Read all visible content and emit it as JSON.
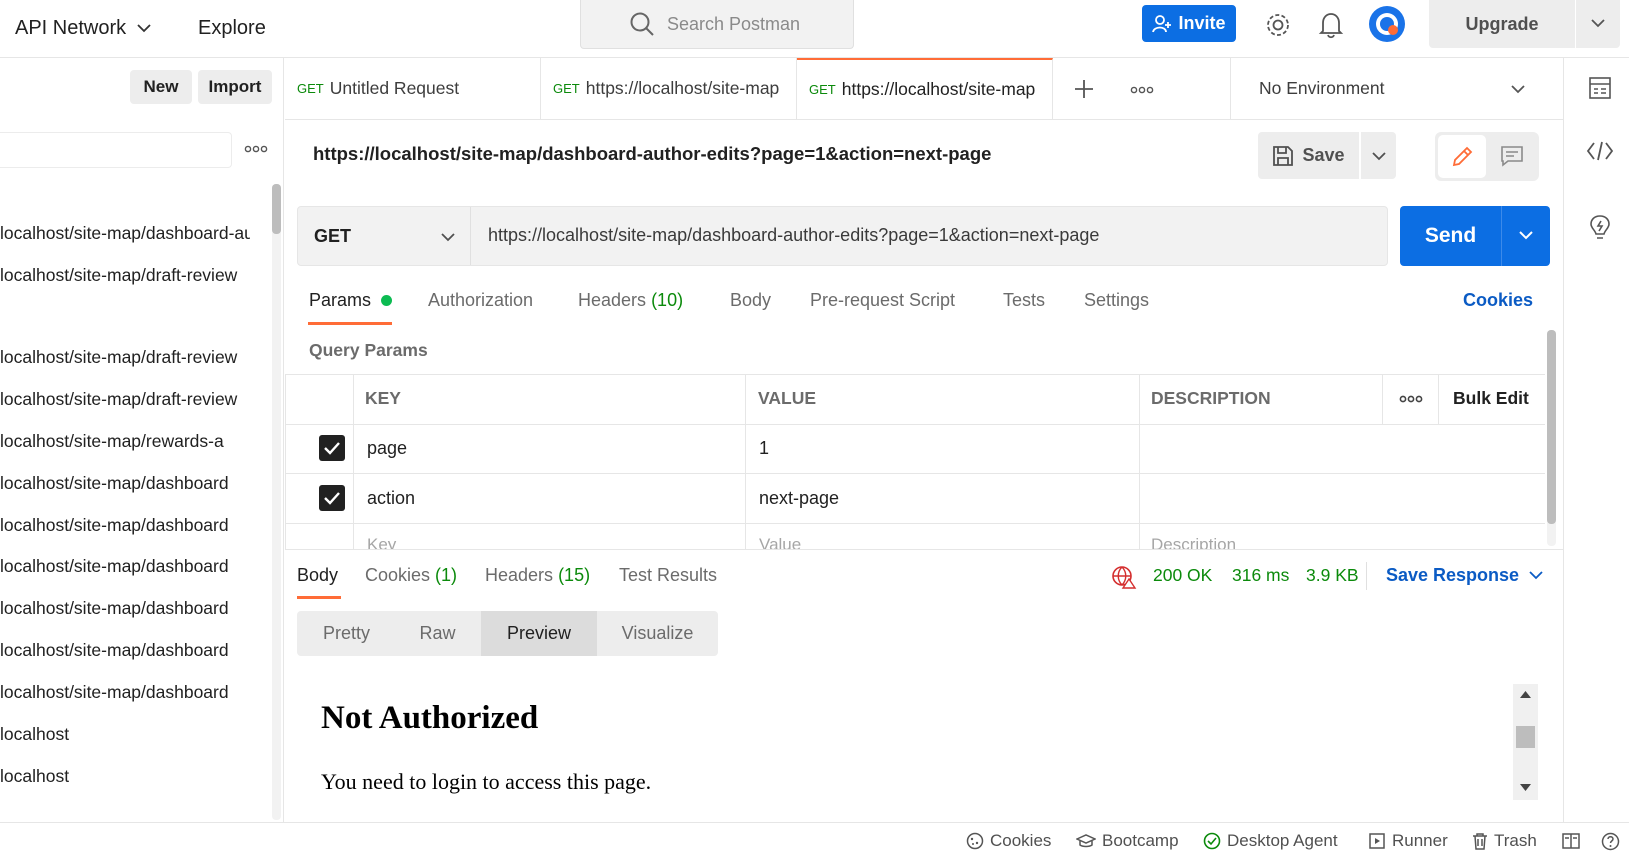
{
  "topbar": {
    "workspace": "API Network",
    "explore": "Explore",
    "search_placeholder": "Search Postman",
    "invite": "Invite",
    "upgrade": "Upgrade"
  },
  "sidebar": {
    "new": "New",
    "import": "Import",
    "items": [
      "localhost/site-map/dashboard-author-edits",
      "localhost/site-map/draft-review",
      "localhost/site-map/draft-review",
      "localhost/site-map/draft-review",
      "localhost/site-map/rewards-a",
      "localhost/site-map/dashboard",
      "localhost/site-map/dashboard",
      "localhost/site-map/dashboard",
      "localhost/site-map/dashboard",
      "localhost/site-map/dashboard",
      "localhost/site-map/dashboard",
      "localhost",
      "localhost"
    ]
  },
  "tabs": [
    {
      "method": "GET",
      "label": "Untitled Request"
    },
    {
      "method": "GET",
      "label": "https://localhost/site-map"
    },
    {
      "method": "GET",
      "label": "https://localhost/site-map"
    }
  ],
  "environment": "No Environment",
  "request": {
    "title": "https://localhost/site-map/dashboard-author-edits?page=1&action=next-page",
    "save": "Save",
    "method": "GET",
    "url": "https://localhost/site-map/dashboard-author-edits?page=1&action=next-page",
    "send": "Send"
  },
  "request_tabs": {
    "params": "Params",
    "authorization": "Authorization",
    "headers": "Headers",
    "headers_count": "(10)",
    "body": "Body",
    "prerequest": "Pre-request Script",
    "tests": "Tests",
    "settings": "Settings",
    "cookies": "Cookies"
  },
  "query_params": {
    "title": "Query Params",
    "columns": {
      "key": "KEY",
      "value": "VALUE",
      "description": "DESCRIPTION",
      "bulk_edit": "Bulk Edit"
    },
    "rows": [
      {
        "key": "page",
        "value": "1",
        "checked": true
      },
      {
        "key": "action",
        "value": "next-page",
        "checked": true
      }
    ],
    "placeholder": {
      "key": "Key",
      "value": "Value",
      "description": "Description"
    }
  },
  "response": {
    "tabs": {
      "body": "Body",
      "cookies": "Cookies",
      "cookies_count": "(1)",
      "headers": "Headers",
      "headers_count": "(15)",
      "tests": "Test Results"
    },
    "status": "200 OK",
    "time": "316 ms",
    "size": "3.9 KB",
    "save_response": "Save Response",
    "views": [
      "Pretty",
      "Raw",
      "Preview",
      "Visualize"
    ],
    "preview": {
      "heading": "Not Authorized",
      "text": "You need to login to access this page."
    }
  },
  "statusbar": {
    "cookies": "Cookies",
    "bootcamp": "Bootcamp",
    "agent": "Desktop Agent",
    "runner": "Runner",
    "trash": "Trash"
  },
  "colors": {
    "accent_orange": "#ff6c37",
    "primary_blue": "#0c6ee3",
    "success_green": "#0b8a0b"
  }
}
